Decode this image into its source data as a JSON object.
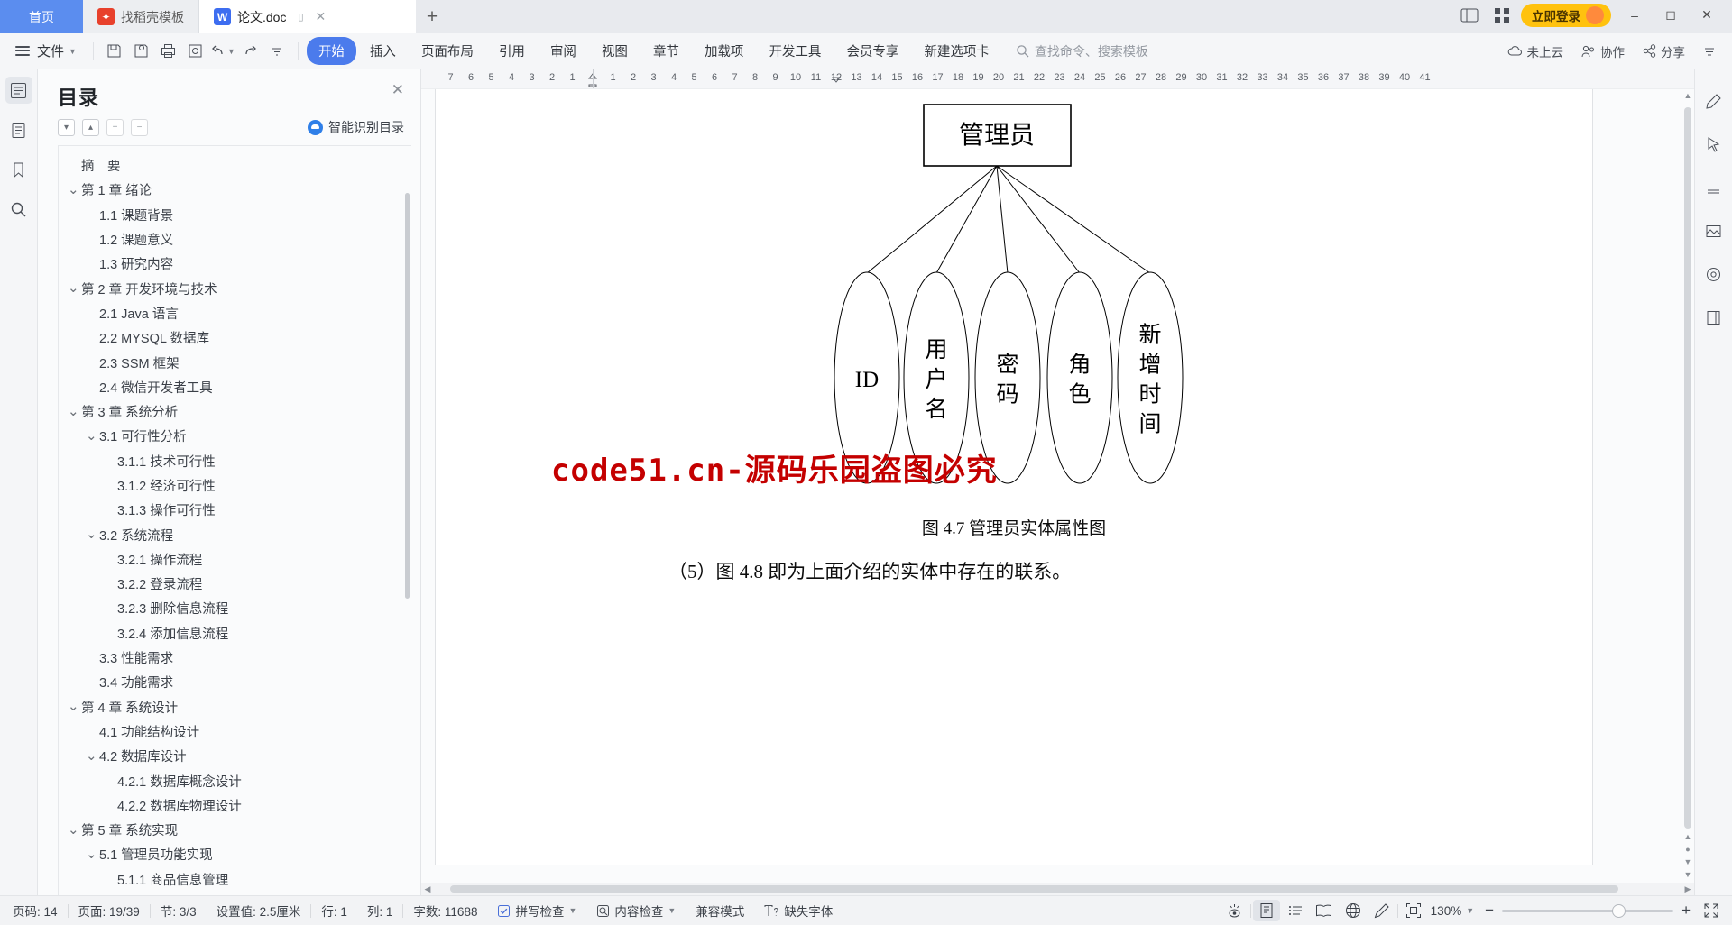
{
  "tabbar": {
    "tabs": [
      {
        "label": "首页",
        "icon": "home-icon",
        "state": "home"
      },
      {
        "label": "找稻壳模板",
        "icon": "docer-icon",
        "state": "inactive"
      },
      {
        "label": "论文.doc",
        "icon": "wps-writer-icon",
        "state": "active"
      }
    ],
    "new_tab": "+",
    "login_label": "立即登录"
  },
  "ribbon": {
    "file_label": "文件",
    "tabs": [
      {
        "label": "开始",
        "selected": true
      },
      {
        "label": "插入",
        "selected": false
      },
      {
        "label": "页面布局",
        "selected": false
      },
      {
        "label": "引用",
        "selected": false
      },
      {
        "label": "审阅",
        "selected": false
      },
      {
        "label": "视图",
        "selected": false
      },
      {
        "label": "章节",
        "selected": false
      },
      {
        "label": "加载项",
        "selected": false
      },
      {
        "label": "开发工具",
        "selected": false
      },
      {
        "label": "会员专享",
        "selected": false
      },
      {
        "label": "新建选项卡",
        "selected": false
      }
    ],
    "search_placeholder": "查找命令、搜索模板",
    "right_items": [
      {
        "label": "未上云",
        "icon": "cloud-icon"
      },
      {
        "label": "协作",
        "icon": "collaborate-icon"
      },
      {
        "label": "分享",
        "icon": "share-icon"
      }
    ]
  },
  "toc": {
    "title": "目录",
    "smart_label": "智能识别目录",
    "items": [
      {
        "text": "摘　要",
        "indent": 0,
        "chev": ""
      },
      {
        "text": "第 1 章 绪论",
        "indent": 0,
        "chev": "v"
      },
      {
        "text": "1.1 课题背景",
        "indent": 1,
        "chev": ""
      },
      {
        "text": "1.2 课题意义",
        "indent": 1,
        "chev": ""
      },
      {
        "text": "1.3 研究内容",
        "indent": 1,
        "chev": ""
      },
      {
        "text": "第 2 章 开发环境与技术",
        "indent": 0,
        "chev": "v"
      },
      {
        "text": "2.1 Java 语言",
        "indent": 1,
        "chev": ""
      },
      {
        "text": "2.2 MYSQL 数据库",
        "indent": 1,
        "chev": ""
      },
      {
        "text": "2.3 SSM 框架",
        "indent": 1,
        "chev": ""
      },
      {
        "text": "2.4 微信开发者工具",
        "indent": 1,
        "chev": ""
      },
      {
        "text": "第 3 章 系统分析",
        "indent": 0,
        "chev": "v"
      },
      {
        "text": "3.1 可行性分析",
        "indent": 1,
        "chev": "v"
      },
      {
        "text": "3.1.1 技术可行性",
        "indent": 2,
        "chev": ""
      },
      {
        "text": "3.1.2 经济可行性",
        "indent": 2,
        "chev": ""
      },
      {
        "text": "3.1.3 操作可行性",
        "indent": 2,
        "chev": ""
      },
      {
        "text": "3.2 系统流程",
        "indent": 1,
        "chev": "v"
      },
      {
        "text": "3.2.1 操作流程",
        "indent": 2,
        "chev": ""
      },
      {
        "text": "3.2.2 登录流程",
        "indent": 2,
        "chev": ""
      },
      {
        "text": "3.2.3 删除信息流程",
        "indent": 2,
        "chev": ""
      },
      {
        "text": "3.2.4 添加信息流程",
        "indent": 2,
        "chev": ""
      },
      {
        "text": "3.3 性能需求",
        "indent": 1,
        "chev": ""
      },
      {
        "text": "3.4 功能需求",
        "indent": 1,
        "chev": ""
      },
      {
        "text": "第 4 章 系统设计",
        "indent": 0,
        "chev": "v"
      },
      {
        "text": "4.1 功能结构设计",
        "indent": 1,
        "chev": ""
      },
      {
        "text": "4.2 数据库设计",
        "indent": 1,
        "chev": "v"
      },
      {
        "text": "4.2.1 数据库概念设计",
        "indent": 2,
        "chev": ""
      },
      {
        "text": "4.2.2 数据库物理设计",
        "indent": 2,
        "chev": ""
      },
      {
        "text": "第 5 章 系统实现",
        "indent": 0,
        "chev": "v"
      },
      {
        "text": "5.1 管理员功能实现",
        "indent": 1,
        "chev": "v"
      },
      {
        "text": "5.1.1 商品信息管理",
        "indent": 2,
        "chev": ""
      }
    ]
  },
  "ruler": {
    "left_ticks": [
      "7",
      "6",
      "5",
      "4",
      "3",
      "2",
      "1"
    ],
    "right_ticks": [
      "1",
      "2",
      "3",
      "4",
      "5",
      "6",
      "7",
      "8",
      "9",
      "10",
      "11",
      "12",
      "13",
      "14",
      "15",
      "16",
      "17",
      "18",
      "19",
      "20",
      "21",
      "22",
      "23",
      "24",
      "25",
      "26",
      "27",
      "28",
      "29",
      "30",
      "31",
      "32",
      "33",
      "34",
      "35",
      "36",
      "37",
      "38",
      "39",
      "40",
      "41"
    ]
  },
  "document": {
    "entity": "管理员",
    "attributes": [
      "ID",
      "用户名",
      "密码",
      "角色",
      "新增时间"
    ],
    "figure_caption": "图 4.7 管理员实体属性图",
    "paragraph": "（5）图 4.8 即为上面介绍的实体中存在的联系。",
    "watermark": "code51.cn-源码乐园盗图必究",
    "watermark_color": "#c40000"
  },
  "status": {
    "page_no": "页码: 14",
    "page_count": "页面: 19/39",
    "section": "节: 3/3",
    "setting": "设置值: 2.5厘米",
    "row": "行: 1",
    "col": "列: 1",
    "words": "字数: 11688",
    "spellcheck": "拼写检查",
    "contentcheck": "内容检查",
    "compat_mode": "兼容模式",
    "missing_font": "缺失字体",
    "zoom": "130%",
    "zoom_minus": "−",
    "zoom_plus": "+"
  }
}
